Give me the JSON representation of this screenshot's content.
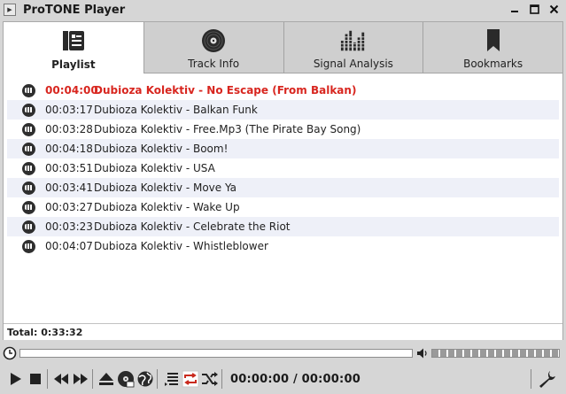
{
  "window": {
    "title": "ProTONE Player",
    "controls": {
      "minimize": "—",
      "maximize": "□",
      "close": "✕"
    }
  },
  "tabs": [
    {
      "label": "Playlist",
      "icon": "playlist-icon",
      "active": true
    },
    {
      "label": "Track Info",
      "icon": "vinyl-disc-icon",
      "active": false
    },
    {
      "label": "Signal Analysis",
      "icon": "equalizer-bars-icon",
      "active": false
    },
    {
      "label": "Bookmarks",
      "icon": "bookmark-icon",
      "active": false
    }
  ],
  "playlist": {
    "items": [
      {
        "duration": "00:04:00",
        "title": "Dubioza Kolektiv - No Escape (From Balkan)",
        "playing": true
      },
      {
        "duration": "00:03:17",
        "title": "Dubioza Kolektiv - Balkan Funk",
        "playing": false
      },
      {
        "duration": "00:03:28",
        "title": "Dubioza Kolektiv - Free.Mp3 (The Pirate Bay Song)",
        "playing": false
      },
      {
        "duration": "00:04:18",
        "title": "Dubioza Kolektiv - Boom!",
        "playing": false
      },
      {
        "duration": "00:03:51",
        "title": "Dubioza Kolektiv - USA",
        "playing": false
      },
      {
        "duration": "00:03:41",
        "title": "Dubioza Kolektiv - Move Ya",
        "playing": false
      },
      {
        "duration": "00:03:27",
        "title": "Dubioza Kolektiv - Wake Up",
        "playing": false
      },
      {
        "duration": "00:03:23",
        "title": "Dubioza Kolektiv - Celebrate the Riot",
        "playing": false
      },
      {
        "duration": "00:04:07",
        "title": "Dubioza Kolektiv - Whistleblower",
        "playing": false
      }
    ],
    "total": "Total: 0:33:32"
  },
  "player": {
    "time": "00:00:00 / 00:00:00",
    "seek_position": 0,
    "volume_level": 0.0
  },
  "colors": {
    "playing_text": "#d8261f",
    "alt_row": "#eef0f8",
    "tab_inactive": "#cfcfcf",
    "window_bg": "#d6d6d6"
  }
}
